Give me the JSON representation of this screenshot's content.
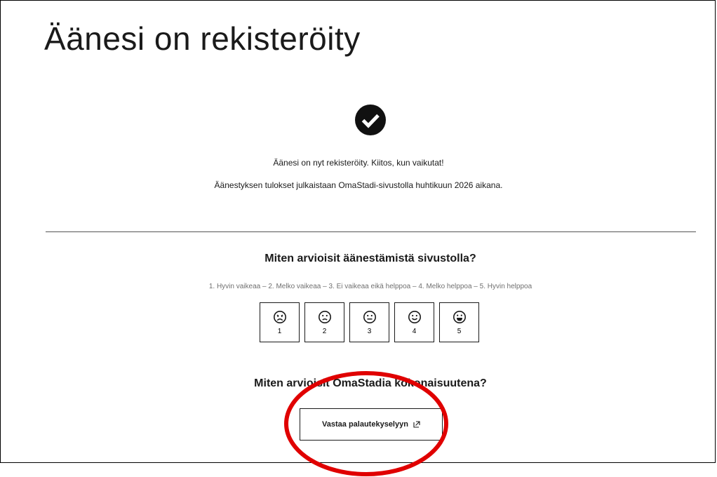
{
  "page": {
    "title": "Äänesi on rekisteröity"
  },
  "confirmation": {
    "icon": "check-circle-icon",
    "message": "Äänesi on nyt rekisteröity. Kiitos, kun vaikutat!",
    "results_info": "Äänestyksen tulokset julkaistaan OmaStadi-sivustolla huhtikuun 2026 aikana."
  },
  "rating": {
    "question": "Miten arvioisit äänestämistä sivustolla?",
    "scale_legend": "1. Hyvin vaikeaa – 2. Melko vaikeaa – 3. Ei vaikeaa eikä helppoa – 4. Melko helppoa – 5. Hyvin helppoa",
    "options": [
      {
        "value": "1",
        "icon": "very-sad-face-icon"
      },
      {
        "value": "2",
        "icon": "sad-face-icon"
      },
      {
        "value": "3",
        "icon": "neutral-face-icon"
      },
      {
        "value": "4",
        "icon": "smile-face-icon"
      },
      {
        "value": "5",
        "icon": "big-smile-face-icon"
      }
    ]
  },
  "overall": {
    "question": "Miten arvioisit OmaStadia kokonaisuutena?",
    "button_label": "Vastaa palautekyselyyn",
    "button_icon": "external-link-icon"
  },
  "colors": {
    "text": "#1a1a1a",
    "muted": "#707070",
    "annotation": "#e00000"
  }
}
